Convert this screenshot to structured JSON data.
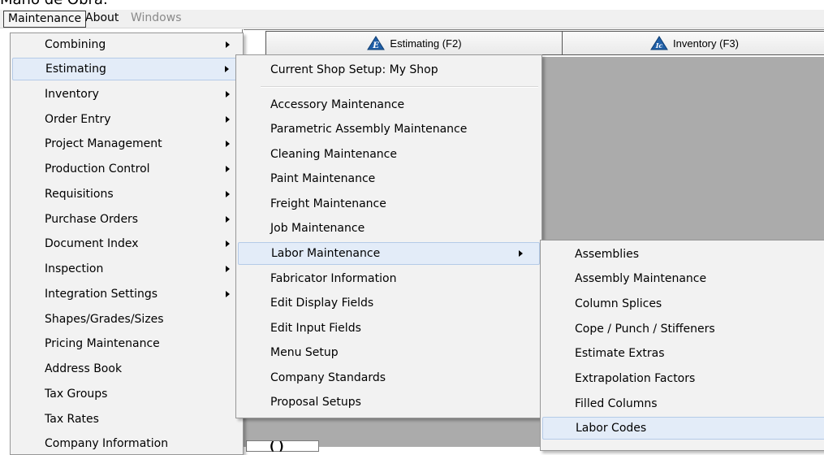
{
  "window_title_partial": "Maño de Obra.",
  "menubar": {
    "items": [
      {
        "label": "Maintenance",
        "state": "active"
      },
      {
        "label": "About",
        "state": "normal"
      },
      {
        "label": "Windows",
        "state": "disabled"
      }
    ]
  },
  "toolbar": {
    "estimating_label": "Estimating (F2)",
    "estimating_icon_letter": "E",
    "inventory_label": "Inventory (F3)",
    "inventory_icon_letters": "Ic"
  },
  "background_fragment": "( )",
  "maintenance_menu": {
    "items": [
      {
        "label": "Combining",
        "submenu": true
      },
      {
        "label": "Estimating",
        "submenu": true,
        "highlighted": true
      },
      {
        "label": "Inventory",
        "submenu": true
      },
      {
        "label": "Order Entry",
        "submenu": true
      },
      {
        "label": "Project Management",
        "submenu": true
      },
      {
        "label": "Production Control",
        "submenu": true
      },
      {
        "label": "Requisitions",
        "submenu": true
      },
      {
        "label": "Purchase Orders",
        "submenu": true
      },
      {
        "label": "Document Index",
        "submenu": true
      },
      {
        "label": "Inspection",
        "submenu": true
      },
      {
        "label": "Integration Settings",
        "submenu": true
      },
      {
        "label": "Shapes/Grades/Sizes",
        "submenu": false
      },
      {
        "label": "Pricing Maintenance",
        "submenu": false
      },
      {
        "label": "Address Book",
        "submenu": false
      },
      {
        "label": "Tax Groups",
        "submenu": false
      },
      {
        "label": "Tax Rates",
        "submenu": false
      },
      {
        "label": "Company Information",
        "submenu": false
      }
    ]
  },
  "estimating_menu": {
    "items": [
      {
        "label": "Current Shop Setup: My Shop",
        "submenu": false
      },
      {
        "label": "Accessory Maintenance",
        "submenu": false
      },
      {
        "label": "Parametric Assembly Maintenance",
        "submenu": false
      },
      {
        "label": "Cleaning Maintenance",
        "submenu": false
      },
      {
        "label": "Paint Maintenance",
        "submenu": false
      },
      {
        "label": "Freight Maintenance",
        "submenu": false
      },
      {
        "label": "Job Maintenance",
        "submenu": false
      },
      {
        "label": "Labor Maintenance",
        "submenu": true,
        "highlighted": true
      },
      {
        "label": "Fabricator Information",
        "submenu": false
      },
      {
        "label": "Edit Display Fields",
        "submenu": false
      },
      {
        "label": "Edit Input Fields",
        "submenu": false
      },
      {
        "label": "Menu Setup",
        "submenu": false
      },
      {
        "label": "Company Standards",
        "submenu": false
      },
      {
        "label": "Proposal Setups",
        "submenu": false
      }
    ]
  },
  "labor_menu": {
    "items": [
      {
        "label": "Assemblies"
      },
      {
        "label": "Assembly Maintenance"
      },
      {
        "label": "Column Splices"
      },
      {
        "label": "Cope / Punch / Stiffeners"
      },
      {
        "label": "Estimate Extras"
      },
      {
        "label": "Extrapolation Factors"
      },
      {
        "label": "Filled Columns"
      },
      {
        "label": "Labor Codes",
        "highlighted": true
      }
    ]
  },
  "colors": {
    "menu_bg": "#f2f2f2",
    "highlight_bg": "#e3ecf8",
    "highlight_border": "#b5cbe8",
    "workspace_gray": "#ababab",
    "icon_blue": "#1f5fa8"
  }
}
